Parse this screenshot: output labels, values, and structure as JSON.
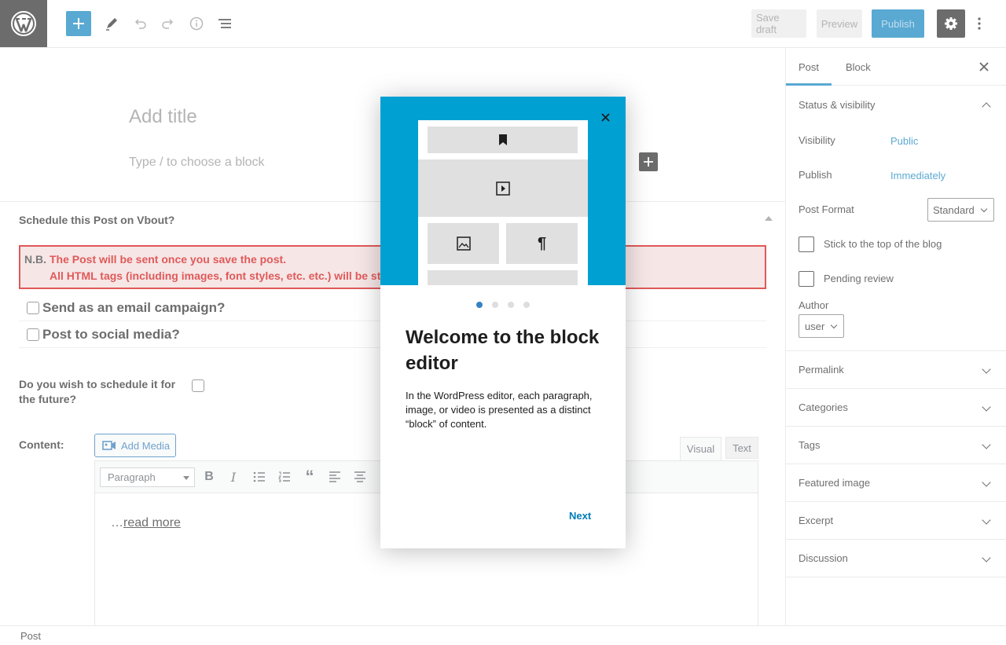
{
  "topbar": {
    "save_draft": "Save draft",
    "preview": "Preview",
    "publish": "Publish",
    "icons": [
      "wordpress-logo",
      "plus-icon",
      "pencil-icon",
      "undo-icon",
      "redo-icon",
      "info-icon",
      "list-view-icon",
      "gear-icon",
      "more-vertical-icon"
    ]
  },
  "editor": {
    "title_placeholder": "Add title",
    "block_placeholder": "Type / to choose a block"
  },
  "metabox": {
    "title": "Schedule this Post on Vbout?",
    "notice_prefix": "N.B.",
    "notice_line1": "The Post will be sent once you save the post.",
    "notice_line2": "All HTML tags (including images, font styles, etc. etc.) will be st",
    "email_campaign": "Send as an email campaign?",
    "social_media": "Post to social media?",
    "schedule_question": "Do you wish to schedule it for the future?",
    "content_label": "Content:",
    "add_media": "Add Media",
    "tab_visual": "Visual",
    "tab_text": "Text",
    "format_select": "Paragraph",
    "content_prefix": "…",
    "read_more": "read more"
  },
  "sidebar": {
    "tab_post": "Post",
    "tab_block": "Block",
    "status_visibility": "Status & visibility",
    "visibility_label": "Visibility",
    "visibility_value": "Public",
    "publish_label": "Publish",
    "publish_value": "Immediately",
    "post_format_label": "Post Format",
    "post_format_value": "Standard",
    "sticky": "Stick to the top of the blog",
    "pending": "Pending review",
    "author_label": "Author",
    "author_value": "user",
    "panels": [
      "Permalink",
      "Categories",
      "Tags",
      "Featured image",
      "Excerpt",
      "Discussion"
    ]
  },
  "modal": {
    "heading": "Welcome to the block editor",
    "text": "In the WordPress editor, each paragraph, image, or video is presented as a distinct “block” of content.",
    "next": "Next",
    "pages": 4,
    "current_page": 1
  },
  "statusbar": {
    "breadcrumb": "Post"
  },
  "colors": {
    "accent": "#007cba",
    "hero": "#00a0d2",
    "notice_red": "#d00000"
  }
}
